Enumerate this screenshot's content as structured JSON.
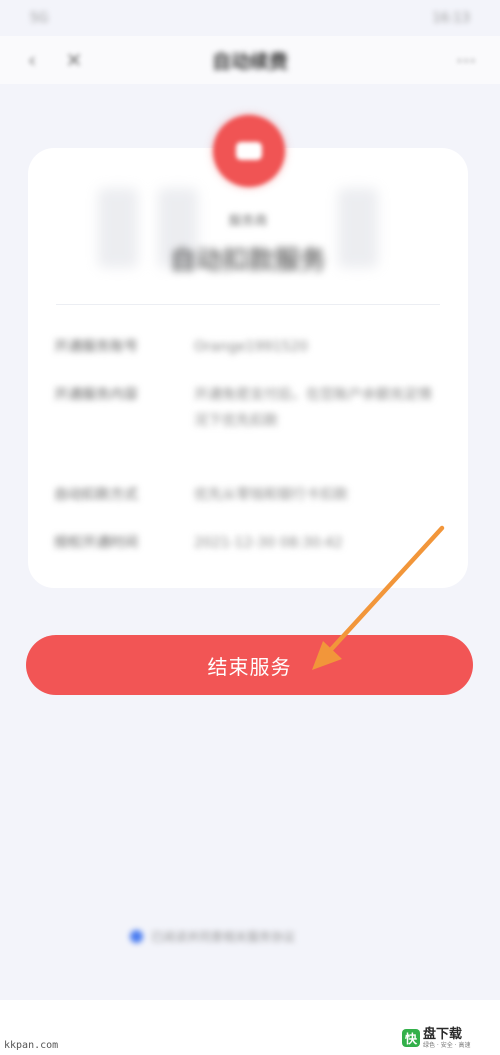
{
  "status_bar": {
    "left": "5G",
    "right": "16:13"
  },
  "nav": {
    "back_icon": "chevron-left-icon",
    "close_icon": "close-icon",
    "title": "自动续费",
    "more_icon": "more-icon"
  },
  "card": {
    "logo_icon": "service-logo-icon",
    "subtitle": "服务商",
    "title": "自动扣款服务",
    "rows": [
      {
        "label": "开通服务账号",
        "value": "Orange1991520"
      },
      {
        "label": "开通服务内容",
        "value": "开通免密支付后，在您账户余额充足情况下优先扣款"
      },
      {
        "label": "自动扣款方式",
        "value": "优先从零钱和银行卡扣款"
      },
      {
        "label": "授权开通时间",
        "value": "2021-12-30 08:30:42"
      }
    ]
  },
  "end_button_label": "结束服务",
  "agreement": {
    "text": "已阅读并同意相关服务协议"
  },
  "watermark": {
    "left_text": "kkpan.com",
    "icon_char": "快",
    "main_text": "盘下载",
    "sub_text": "绿色 · 安全 · 高速"
  },
  "colors": {
    "accent": "#f25555",
    "arrow": "#f2963a",
    "background": "#f3f4fa",
    "checkbox": "#4a7cf0"
  }
}
